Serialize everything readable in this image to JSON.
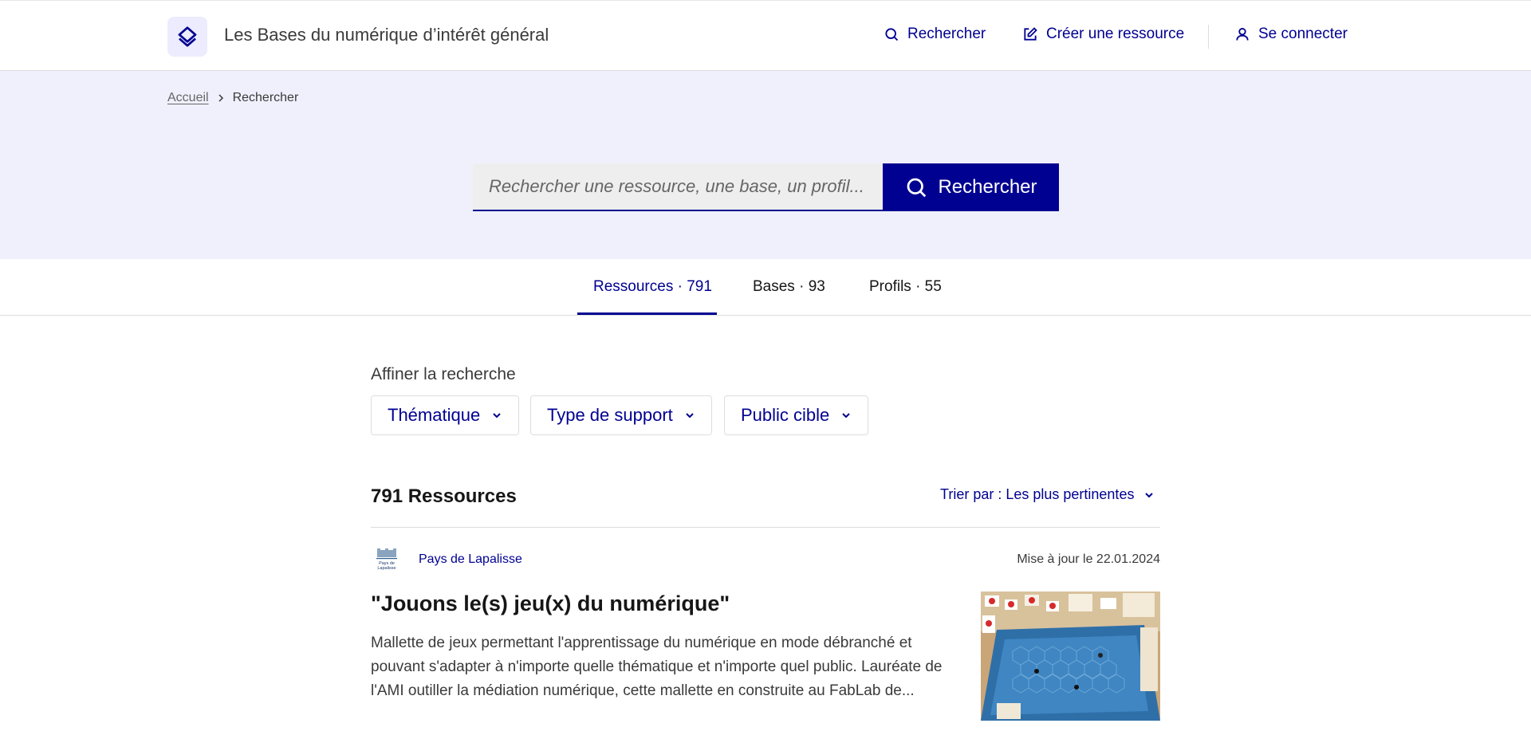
{
  "header": {
    "site_title": "Les Bases du numérique d’intérêt général",
    "nav": {
      "search": "Rechercher",
      "create": "Créer une ressource",
      "login": "Se connecter"
    }
  },
  "breadcrumb": {
    "home": "Accueil",
    "current": "Rechercher"
  },
  "search": {
    "placeholder": "Rechercher une ressource, une base, un profil...",
    "button": "Rechercher"
  },
  "tabs": [
    {
      "label": "Ressources · 791",
      "active": true
    },
    {
      "label": "Bases · 93",
      "active": false
    },
    {
      "label": "Profils · 55",
      "active": false
    }
  ],
  "filters": {
    "title": "Affiner la recherche",
    "items": [
      "Thématique",
      "Type de support",
      "Public cible"
    ]
  },
  "results": {
    "count_label": "791 Ressources",
    "sort_label": "Trier par : Les plus pertinentes"
  },
  "resources": [
    {
      "base_name": "Pays de Lapalisse",
      "base_logo_text": "Pays de Lapalisse",
      "updated": "Mise à jour le 22.01.2024",
      "title": "\"Jouons le(s) jeu(x) du numérique\"",
      "description": "Mallette de jeux permettant l'apprentissage du numérique en mode débranché et pouvant s'adapter à n'importe quelle thématique et n'importe quel public. Lauréate de l'AMI outiller la médiation numérique, cette mallette en construite au FabLab de..."
    }
  ],
  "colors": {
    "primary": "#000091",
    "hero_bg": "#f0f0fd",
    "logo_bg": "#ececfe"
  },
  "icons": {
    "logo": "layers-icon",
    "search": "search-icon",
    "create": "edit-icon",
    "login": "user-icon",
    "chevron": "chevron-down-icon",
    "breadcrumb_sep": "chevron-right-icon"
  }
}
